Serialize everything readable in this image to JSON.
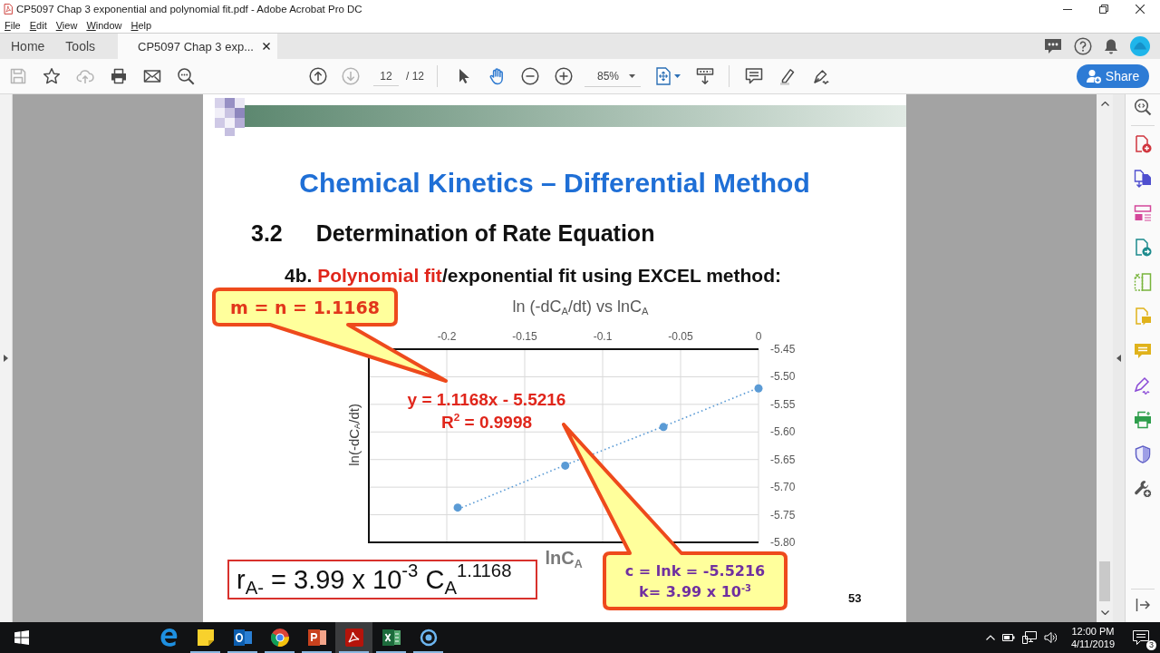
{
  "window": {
    "title": "CP5097 Chap 3 exponential and polynomial fit.pdf - Adobe Acrobat Pro DC"
  },
  "menu": [
    "File",
    "Edit",
    "View",
    "Window",
    "Help"
  ],
  "tabs": [
    {
      "label": "Home",
      "selected": false,
      "closable": false
    },
    {
      "label": "Tools",
      "selected": false,
      "closable": false
    },
    {
      "label": "CP5097 Chap 3 exp...",
      "selected": true,
      "closable": true
    }
  ],
  "toolbar": {
    "file_buttons": [
      {
        "kind": "save",
        "disabled": true
      },
      {
        "kind": "star",
        "disabled": false
      },
      {
        "kind": "upload",
        "disabled": true
      },
      {
        "kind": "print",
        "disabled": false
      },
      {
        "kind": "mail",
        "disabled": false
      },
      {
        "kind": "find",
        "disabled": false
      }
    ],
    "nav_buttons": [
      {
        "kind": "previous",
        "disabled": false
      },
      {
        "kind": "next",
        "disabled": true
      }
    ],
    "page": "12",
    "page_count": "/ 12",
    "tools": [
      {
        "kind": "select",
        "selected": false
      },
      {
        "kind": "hand",
        "selected": true
      }
    ],
    "zoom": "85%",
    "share": "Share"
  },
  "document": {
    "title": "Chemical Kinetics – Differential Method",
    "section": {
      "number": "3.2",
      "title": "Determination of Rate Equation"
    },
    "subheading": [
      {
        "text": "4b. ",
        "highlight": false
      },
      {
        "text": "Polynomial fit",
        "highlight": true
      },
      {
        "text": "/exponential fit using EXCEL method:",
        "highlight": false
      }
    ],
    "chart_data": {
      "type": "scatter",
      "title": "ln (-dC$_{A}$/dt) vs lnC$_{A}$",
      "xlabel": "lnC$_{A}$",
      "ylabel": "ln(-dC$_{A}$/dt)",
      "x": [
        -0.193,
        -0.124,
        -0.061,
        0
      ],
      "series": [
        {
          "color": "#5b9bd5",
          "values": [
            -5.737,
            -5.661,
            -5.591,
            -5.521
          ]
        },
        {
          "type": "line",
          "line_style": "dotted",
          "color": "#5b9bd5",
          "values": [
            -5.74,
            -5.66,
            -5.59,
            -5.52
          ]
        }
      ],
      "xlim": [
        -0.25,
        0
      ],
      "ylim": [
        -5.8,
        -5.45
      ],
      "xticks": [
        -0.2,
        -0.15,
        -0.1,
        -0.05,
        0
      ],
      "yticks": [
        {
          "value": -5.45,
          "label": "-5.45"
        },
        {
          "value": -5.5,
          "label": "-5.50"
        },
        {
          "value": -5.55,
          "label": "-5.55"
        },
        {
          "value": -5.6,
          "label": "-5.60"
        },
        {
          "value": -5.65,
          "label": "-5.65"
        },
        {
          "value": -5.7,
          "label": "-5.70"
        },
        {
          "value": -5.75,
          "label": "-5.75"
        },
        {
          "value": -5.8,
          "label": "-5.80"
        }
      ],
      "grid": true,
      "annotations": [
        "y = 1.1168x - 5.5216",
        "R$^{2}$ = 0.9998"
      ]
    },
    "slope_callout": [
      "m = n = 1.1168"
    ],
    "intercept_callout": [
      "c = lnk = -5.5216",
      "k= 3.99 x 10$^{-3}$"
    ],
    "rate_equation": "r$_{A-}$ = 3.99 x 10$^{-3}$ C$_{A}$$^{1.1168}$",
    "page_number": "53"
  },
  "taskbar": {
    "apps": [
      {
        "kind": "browser",
        "running": false,
        "selected": false
      },
      {
        "kind": "note",
        "running": true,
        "selected": false
      },
      {
        "kind": "mail",
        "running": true,
        "selected": false
      },
      {
        "kind": "globe",
        "running": true,
        "selected": false
      },
      {
        "kind": "slides",
        "running": true,
        "selected": false
      },
      {
        "kind": "pdf",
        "running": true,
        "selected": true
      },
      {
        "kind": "sheet",
        "running": true,
        "selected": false
      },
      {
        "kind": "recorder",
        "running": true,
        "selected": false
      }
    ],
    "time": "12:00 PM",
    "date": "4/11/2019",
    "notifications": "3"
  }
}
